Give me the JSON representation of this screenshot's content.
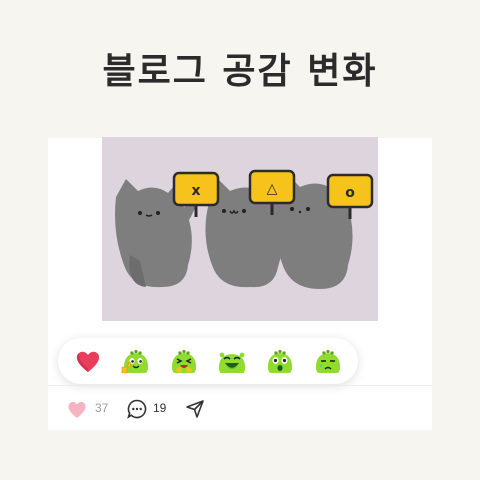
{
  "title": "블로그 공감 변화",
  "post": {
    "like_count": "37",
    "comment_count": "19"
  },
  "reactions": [
    {
      "name": "heart",
      "icon": "heart-icon"
    },
    {
      "name": "thumbs-up",
      "icon": "thumbs-up-emoji-icon"
    },
    {
      "name": "laughing",
      "icon": "laughing-emoji-icon"
    },
    {
      "name": "grinning",
      "icon": "grinning-emoji-icon"
    },
    {
      "name": "surprised",
      "icon": "surprised-emoji-icon"
    },
    {
      "name": "sad",
      "icon": "sad-emoji-icon"
    }
  ],
  "sign_faces": [
    "x",
    "△",
    "o"
  ],
  "colors": {
    "heart": "#e83e5b",
    "heart_light": "#f6b3c1",
    "emoji_green": "#8fdc2f",
    "sign_yellow": "#f6c21c",
    "photo_bg": "#ddd4de"
  }
}
